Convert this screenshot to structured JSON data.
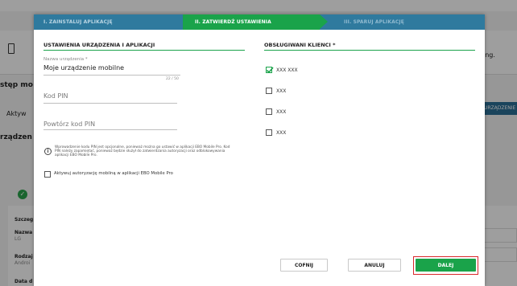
{
  "background": {
    "text_right_top": "ing.",
    "text_left_1": "stęp mo",
    "text_left_tab": "Aktyw",
    "text_left_2": "rządzen",
    "button_right": "URZĄDZENIE",
    "details_rows": [
      "Szczeg",
      "Nazwa",
      "LG",
      "Rodzaj",
      "Androi",
      "Data d"
    ]
  },
  "stepper": {
    "step1": "I. ZAINSTALUJ APLIKACJĘ",
    "step2": "II. ZATWIERDŹ USTAWIENIA",
    "step3": "III. SPARUJ APLIKACJĘ"
  },
  "left_section": {
    "title": "USTAWIENIA URZĄDZENIA I APLIKACJI",
    "device_name_label": "Nazwa urządzenia *",
    "device_name_value": "Moje urządzenie mobilne",
    "device_name_counter": "22 / 50",
    "pin_placeholder": "Kod PIN",
    "pin_repeat_placeholder": "Powtórz kod PIN",
    "info_text": "Wprowadzenie kodu PIN jest opcjonalne, ponieważ można go ustawić w aplikacji EBO Mobile Pro. Kod PIN należy zapamiętać, ponieważ będzie służył do zatwierdzania autoryzacji oraz odblokowywania aplikacji EBO Mobile Pro.",
    "activate_label": "Aktywuj autoryzację mobilną w aplikacji EBO Mobile Pro"
  },
  "right_section": {
    "title": "OBSŁUGIWANI KLIENCI *",
    "clients": [
      {
        "label": "XXX XXX",
        "checked": true
      },
      {
        "label": "XXX",
        "checked": false
      },
      {
        "label": "XXX",
        "checked": false
      },
      {
        "label": "XXX",
        "checked": false
      }
    ]
  },
  "footer": {
    "back": "COFNIJ",
    "cancel": "ANULUJ",
    "next": "DALEJ"
  },
  "colors": {
    "primary_green": "#1aa34a",
    "stepper_blue": "#2f7a9e",
    "highlight_red": "#d9262b"
  }
}
